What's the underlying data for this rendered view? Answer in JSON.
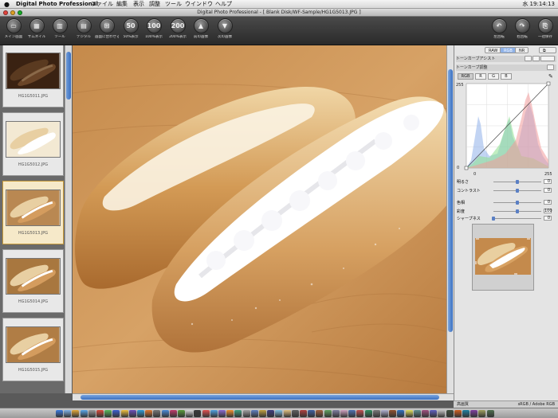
{
  "menubar": {
    "app_name": "Digital Photo Professional",
    "items": [
      "ファイル",
      "編集",
      "表示",
      "調整",
      "ツール",
      "ウインドウ",
      "ヘルプ"
    ],
    "clock": "水 19:14:13"
  },
  "window": {
    "title": "Digital Photo Professional - [ Blank Disk/WF-Sample/HG1G5013.JPG ]"
  },
  "toolbar": {
    "left": [
      {
        "label": "メイン画面",
        "icon": "main-window-icon",
        "glyph": "▭"
      },
      {
        "label": "サムネイル",
        "icon": "thumbnail-icon",
        "glyph": "▦"
      },
      {
        "label": "ツール",
        "icon": "tool-palette-icon",
        "glyph": "▥"
      },
      {
        "label": "デジタル",
        "icon": "digital-icon",
        "glyph": "▤"
      },
      {
        "label": "画面に合わせる",
        "icon": "fit-screen-icon",
        "glyph": "⊞"
      },
      {
        "label": "50%表示",
        "icon": "zoom-50-icon",
        "glyph": "50"
      },
      {
        "label": "100%表示",
        "icon": "zoom-100-icon",
        "glyph": "100"
      },
      {
        "label": "200%表示",
        "icon": "zoom-200-icon",
        "glyph": "200"
      },
      {
        "label": "前の画像",
        "icon": "previous-image-icon",
        "glyph": "▲"
      },
      {
        "label": "次の画像",
        "icon": "next-image-icon",
        "glyph": "▼"
      }
    ],
    "right": [
      {
        "label": "左回転",
        "icon": "rotate-left-icon",
        "glyph": "↶"
      },
      {
        "label": "右回転",
        "icon": "rotate-right-icon",
        "glyph": "↷"
      },
      {
        "label": "一括保存",
        "icon": "batch-save-icon",
        "glyph": "⎘"
      }
    ]
  },
  "thumbnails": [
    {
      "filename": "HG1G5011.JPG",
      "selected": false
    },
    {
      "filename": "HG1G5012.JPG",
      "selected": false
    },
    {
      "filename": "HG1G5013.JPG",
      "selected": true
    },
    {
      "filename": "HG1G5014.JPG",
      "selected": false
    },
    {
      "filename": "HG1G5015.JPG",
      "selected": false
    }
  ],
  "palette": {
    "tabs": [
      "RAW",
      "RGB",
      "NR"
    ],
    "active_tab": "RGB",
    "tone_curve_assist": "トーンカーブアシスト",
    "tone_curve_adjust": "トーンカーブ調整",
    "channels": [
      "RGB",
      "R",
      "G",
      "B"
    ],
    "active_channel": "RGB",
    "histo_max": "255",
    "histo_min": "0",
    "axis_min": "0",
    "axis_max": "255",
    "sliders": [
      {
        "label": "明るさ",
        "value": "0",
        "pos": 0.5
      },
      {
        "label": "コントラスト",
        "value": "0",
        "pos": 0.5
      },
      {
        "label": "色相",
        "value": "0",
        "pos": 0.5
      },
      {
        "label": "彩度",
        "value": "100",
        "pos": 0.5
      },
      {
        "label": "シャープネス",
        "value": "0",
        "pos": 0.0
      }
    ]
  },
  "status": {
    "left": "高画質",
    "right": "sRGB / Adobe RGB"
  }
}
